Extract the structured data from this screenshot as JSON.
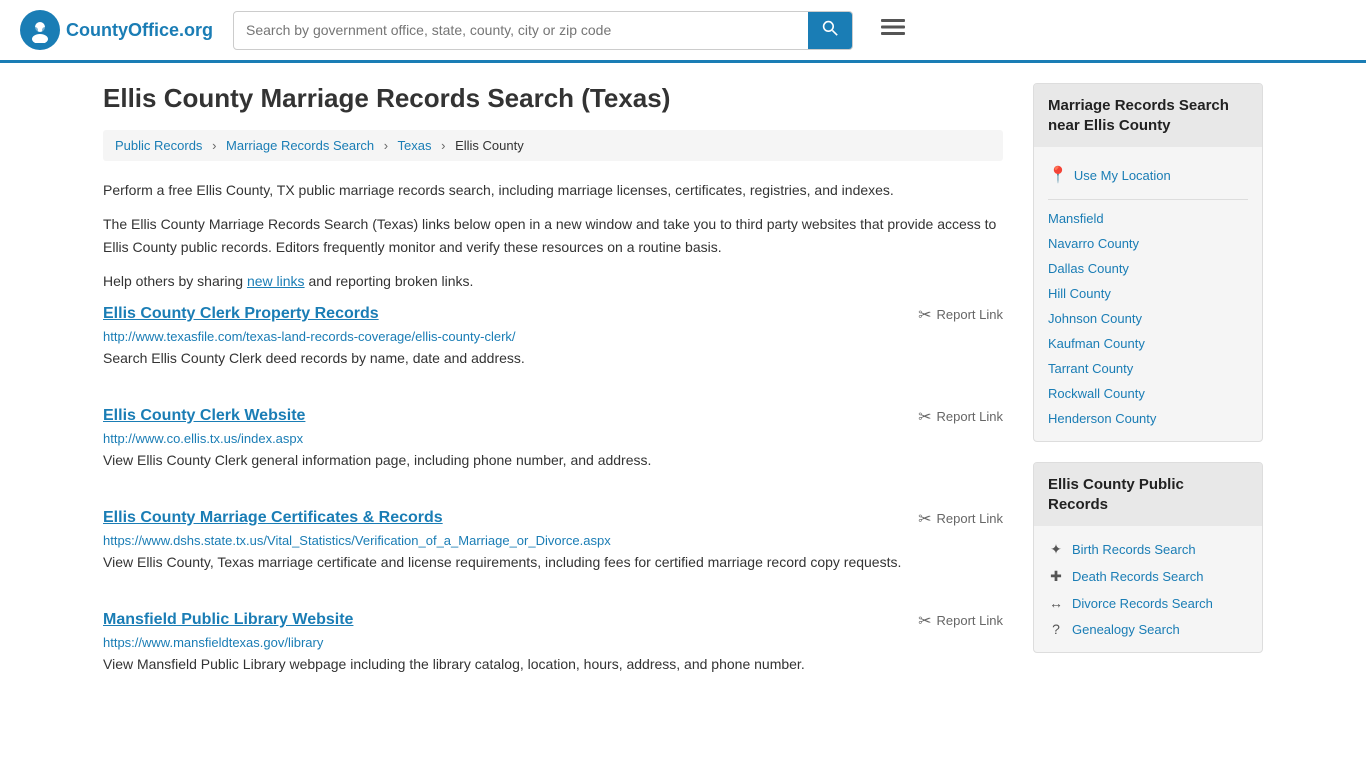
{
  "header": {
    "logo_text": "CountyOffice",
    "logo_org": ".org",
    "search_placeholder": "Search by government office, state, county, city or zip code",
    "search_button_icon": "🔍"
  },
  "page": {
    "title": "Ellis County Marriage Records Search (Texas)",
    "breadcrumb": [
      {
        "label": "Public Records",
        "href": "#"
      },
      {
        "label": "Marriage Records Search",
        "href": "#"
      },
      {
        "label": "Texas",
        "href": "#"
      },
      {
        "label": "Ellis County",
        "href": "#",
        "current": true
      }
    ],
    "description1": "Perform a free Ellis County, TX public marriage records search, including marriage licenses, certificates, registries, and indexes.",
    "description2": "The Ellis County Marriage Records Search (Texas) links below open in a new window and take you to third party websites that provide access to Ellis County public records. Editors frequently monitor and verify these resources on a routine basis.",
    "description3_prefix": "Help others by sharing ",
    "new_links_text": "new links",
    "description3_suffix": " and reporting broken links."
  },
  "results": [
    {
      "title": "Ellis County Clerk Property Records",
      "url": "http://www.texasfile.com/texas-land-records-coverage/ellis-county-clerk/",
      "description": "Search Ellis County Clerk deed records by name, date and address.",
      "report_label": "Report Link"
    },
    {
      "title": "Ellis County Clerk Website",
      "url": "http://www.co.ellis.tx.us/index.aspx",
      "description": "View Ellis County Clerk general information page, including phone number, and address.",
      "report_label": "Report Link"
    },
    {
      "title": "Ellis County Marriage Certificates & Records",
      "url": "https://www.dshs.state.tx.us/Vital_Statistics/Verification_of_a_Marriage_or_Divorce.aspx",
      "description": "View Ellis County, Texas marriage certificate and license requirements, including fees for certified marriage record copy requests.",
      "report_label": "Report Link"
    },
    {
      "title": "Mansfield Public Library Website",
      "url": "https://www.mansfieldtexas.gov/library",
      "description": "View Mansfield Public Library webpage including the library catalog, location, hours, address, and phone number.",
      "report_label": "Report Link"
    }
  ],
  "sidebar": {
    "nearby_title": "Marriage Records Search near Ellis County",
    "use_location_label": "Use My Location",
    "nearby_items": [
      {
        "label": "Mansfield"
      },
      {
        "label": "Navarro County"
      },
      {
        "label": "Dallas County"
      },
      {
        "label": "Hill County"
      },
      {
        "label": "Johnson County"
      },
      {
        "label": "Kaufman County"
      },
      {
        "label": "Tarrant County"
      },
      {
        "label": "Rockwall County"
      },
      {
        "label": "Henderson County"
      }
    ],
    "public_records_title": "Ellis County Public Records",
    "public_records_items": [
      {
        "icon": "birth",
        "label": "Birth Records Search"
      },
      {
        "icon": "death",
        "label": "Death Records Search"
      },
      {
        "icon": "divorce",
        "label": "Divorce Records Search"
      },
      {
        "icon": "genealogy",
        "label": "Genealogy Search"
      }
    ]
  }
}
